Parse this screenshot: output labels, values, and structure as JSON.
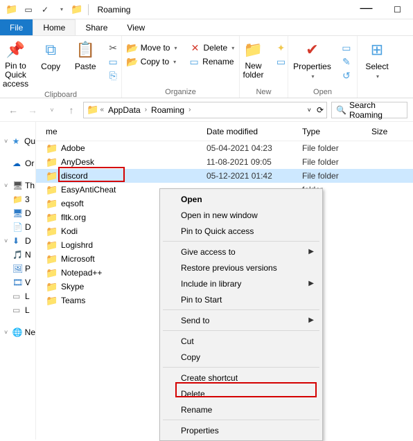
{
  "window": {
    "title": "Roaming"
  },
  "tabs": {
    "file": "File",
    "home": "Home",
    "share": "Share",
    "view": "View"
  },
  "ribbon": {
    "clipboard": {
      "label": "Clipboard",
      "pin": "Pin to Quick access",
      "copy": "Copy",
      "paste": "Paste"
    },
    "organize": {
      "label": "Organize",
      "move": "Move to",
      "copyto": "Copy to",
      "delete": "Delete",
      "rename": "Rename"
    },
    "new": {
      "label": "New",
      "folder": "New folder"
    },
    "open": {
      "label": "Open",
      "properties": "Properties"
    },
    "select": {
      "label": "Select"
    }
  },
  "breadcrumb": {
    "a": "AppData",
    "b": "Roaming"
  },
  "search": {
    "placeholder": "Search Roaming"
  },
  "columns": {
    "name": "me",
    "date": "Date modified",
    "type": "Type",
    "size": "Size"
  },
  "navpane": [
    {
      "chev": "˅",
      "icon": "★",
      "label": "Qu",
      "color": "#3b8fd8"
    },
    {
      "chev": "",
      "icon": "☁",
      "label": "Or",
      "color": "#0a63c0"
    },
    {
      "chev": "˅",
      "icon": "🖥",
      "label": "Th",
      "color": "#555"
    },
    {
      "chev": "",
      "icon": "📁",
      "label": "3",
      "color": "#f0c850"
    },
    {
      "chev": "",
      "icon": "🖥",
      "label": "D",
      "color": "#2d7bc7"
    },
    {
      "chev": "",
      "icon": "📄",
      "label": "D",
      "color": "#6aa6d6"
    },
    {
      "chev": "˅",
      "icon": "⬇",
      "label": "D",
      "color": "#2d7bc7"
    },
    {
      "chev": "",
      "icon": "🎵",
      "label": "N",
      "color": "#2d7bc7"
    },
    {
      "chev": "",
      "icon": "🖼",
      "label": "P",
      "color": "#2d7bc7"
    },
    {
      "chev": "",
      "icon": "🎞",
      "label": "V",
      "color": "#2d7bc7"
    },
    {
      "chev": "",
      "icon": "▭",
      "label": "L",
      "color": "#888"
    },
    {
      "chev": "",
      "icon": "▭",
      "label": "L",
      "color": "#888"
    },
    {
      "chev": "˅",
      "icon": "🌐",
      "label": "Ne",
      "color": "#2d7bc7"
    }
  ],
  "files": [
    {
      "name": "Adobe",
      "date": "05-04-2021 04:23",
      "type": "File folder"
    },
    {
      "name": "AnyDesk",
      "date": "11-08-2021 09:05",
      "type": "File folder"
    },
    {
      "name": "discord",
      "date": "05-12-2021 01:42",
      "type": "File folder",
      "selected": true,
      "highlight": true
    },
    {
      "name": "EasyAntiCheat",
      "date": "",
      "type": "folder"
    },
    {
      "name": "eqsoft",
      "date": "",
      "type": "folder"
    },
    {
      "name": "fltk.org",
      "date": "",
      "type": "folder"
    },
    {
      "name": "Kodi",
      "date": "",
      "type": "folder"
    },
    {
      "name": "Logishrd",
      "date": "",
      "type": "folder"
    },
    {
      "name": "Microsoft",
      "date": "",
      "type": "folder"
    },
    {
      "name": "Notepad++",
      "date": "",
      "type": "folder"
    },
    {
      "name": "Skype",
      "date": "",
      "type": "folder"
    },
    {
      "name": "Teams",
      "date": "",
      "type": "folder"
    }
  ],
  "ctx": {
    "open": "Open",
    "new_window": "Open in new window",
    "pin_qa": "Pin to Quick access",
    "give": "Give access to",
    "restore": "Restore previous versions",
    "library": "Include in library",
    "pin_start": "Pin to Start",
    "sendto": "Send to",
    "cut": "Cut",
    "copy": "Copy",
    "shortcut": "Create shortcut",
    "delete": "Delete",
    "rename": "Rename",
    "props": "Properties"
  }
}
